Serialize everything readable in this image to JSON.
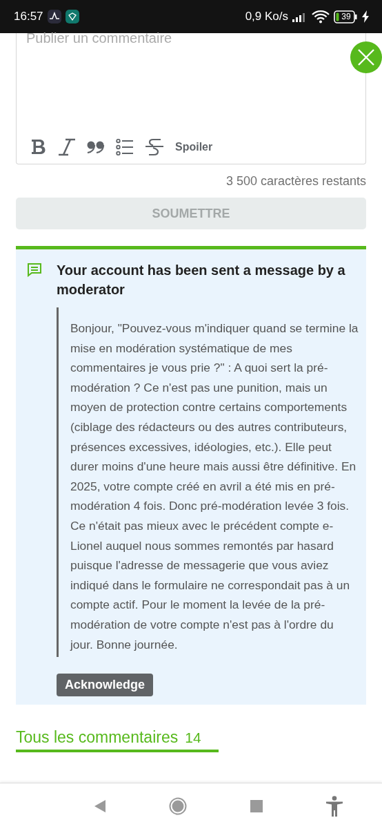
{
  "status_bar": {
    "time": "16:57",
    "network_speed": "0,9 Ko/s",
    "battery": "39"
  },
  "comment_editor": {
    "placeholder": "Publier un commentaire",
    "toolbar": [
      {
        "kind": "bold"
      },
      {
        "kind": "italic"
      },
      {
        "kind": "quote"
      },
      {
        "kind": "list"
      },
      {
        "kind": "strike"
      },
      {
        "kind": "text",
        "label": "Spoiler"
      }
    ],
    "remaining": "3 500 caractères restants",
    "submit": {
      "label": "SOUMETTRE",
      "disabled": true
    }
  },
  "moderator_message": {
    "title": "Your account has been sent a message by a moderator",
    "body": "Bonjour, \"Pouvez-vous m'indiquer quand se termine la mise en modération systématique de mes commentaires je vous prie ?\" : A quoi sert la pré-modération ? Ce n'est pas une punition, mais un moyen de protection contre certains comportements (ciblage des rédacteurs ou des autres contributeurs, présences excessives, idéologies, etc.). Elle peut durer moins d'une heure mais aussi être définitive. En 2025, votre compte créé en avril a été mis en pré-modération 4 fois. Donc pré-modération levée 3 fois. Ce n'était pas mieux avec le précédent compte e-Lionel auquel nous sommes remontés par hasard puisque l'adresse de messagerie que vous aviez indiqué dans le formulaire ne correspondait pas à un compte actif. Pour le moment la levée de la pré-modération de votre compte n'est pas à l'ordre du jour. Bonne journée.",
    "button": "Acknowledge"
  },
  "tabs": [
    {
      "label": "Tous les commentaires",
      "count": "14",
      "selected": true
    }
  ]
}
